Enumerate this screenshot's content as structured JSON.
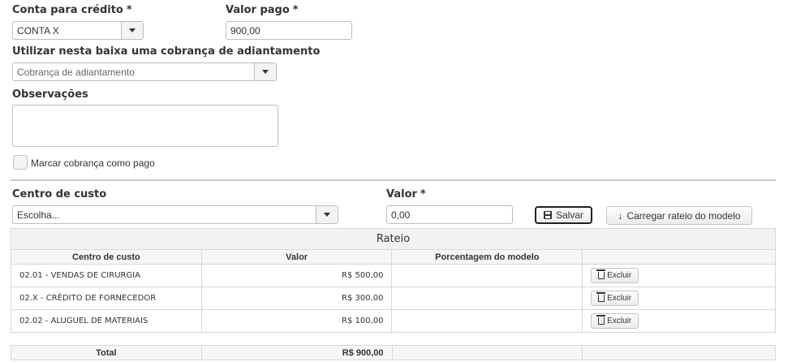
{
  "form": {
    "conta": {
      "label": "Conta para crédito",
      "required": "*",
      "value": "CONTA X"
    },
    "valor_pago": {
      "label": "Valor pago",
      "required": "*",
      "value": "900,00"
    },
    "cobranca": {
      "label": "Utilizar nesta baixa uma cobrança de adiantamento",
      "placeholder": "Cobrança de adiantamento"
    },
    "observacoes": {
      "label": "Observações",
      "value": ""
    },
    "marcar_pago": {
      "label": "Marcar cobrança como pago"
    }
  },
  "rateio_form": {
    "centro": {
      "label": "Centro de custo",
      "placeholder": "Escolha..."
    },
    "valor": {
      "label": "Valor",
      "required": "*",
      "value": "0,00"
    },
    "salvar_label": "Salvar",
    "carregar_label": "Carregar rateio do modelo"
  },
  "table": {
    "caption": "Rateio",
    "columns": [
      "Centro de custo",
      "Valor",
      "Porcentagem do modelo",
      ""
    ],
    "rows": [
      {
        "centro": "02.01 - VENDAS DE CIRURGIA",
        "valor": "R$ 500,00",
        "porcentagem": "",
        "action": "Excluir"
      },
      {
        "centro": "02.X - CRÉDITO DE FORNECEDOR",
        "valor": "R$ 300,00",
        "porcentagem": "",
        "action": "Excluir"
      },
      {
        "centro": "02.02 - ALUGUEL DE MATERIAIS",
        "valor": "R$ 100,00",
        "porcentagem": "",
        "action": "Excluir"
      }
    ],
    "total": {
      "label": "Total",
      "valor": "R$ 900,00"
    }
  },
  "icons": {
    "dropdown": "chevron-down-icon",
    "save": "floppy-disk-icon",
    "download": "arrow-down-icon",
    "delete": "trash-icon"
  }
}
